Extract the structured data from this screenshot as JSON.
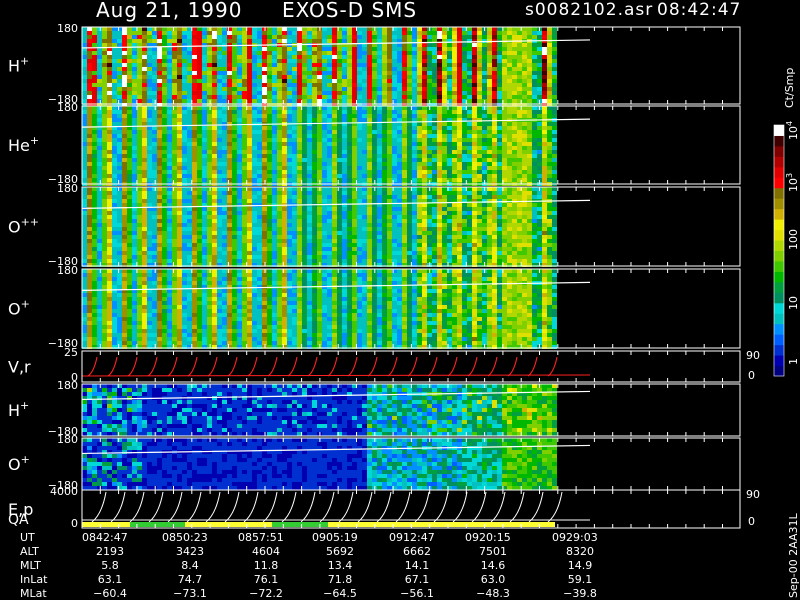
{
  "header": {
    "date": "Aug 21, 1990",
    "instrument": "EXOS-D SMS",
    "file": "s0082102.asr",
    "time": "08:42:47"
  },
  "colorbar": {
    "unit_label": "Ct/Smp",
    "tick_labels": [
      "1",
      "10",
      "100",
      "10",
      "10"
    ],
    "tick_exponents": [
      "",
      "",
      "",
      "3",
      "4"
    ],
    "colors": [
      "#000080",
      "#0000b0",
      "#0030d0",
      "#0060ff",
      "#0090ff",
      "#00c0c0",
      "#00d8d8",
      "#009060",
      "#00a040",
      "#00b800",
      "#40c800",
      "#80d000",
      "#b0d800",
      "#e0e000",
      "#f0f000",
      "#d0b000",
      "#a09000",
      "#807000",
      "#ff0000",
      "#e00000",
      "#b00000",
      "#800000",
      "#400000",
      "#ffffff"
    ]
  },
  "chart_data": {
    "type": "heatmap",
    "panels": [
      {
        "label": "H",
        "superscript": "+",
        "ymax": "180",
        "ymin": "−180"
      },
      {
        "label": "He",
        "superscript": "+",
        "ymax": "180",
        "ymin": "−180"
      },
      {
        "label": "O",
        "superscript": "++",
        "ymax": "180",
        "ymin": "−180"
      },
      {
        "label": "O",
        "superscript": "+",
        "ymax": "180",
        "ymin": "−180"
      },
      {
        "label": "V,r",
        "superscript": "",
        "ymax": "25",
        "ymin": "0",
        "right_max": "90",
        "right_min": "0"
      },
      {
        "label": "H",
        "superscript": "+",
        "ymax": "180",
        "ymin": "−180"
      },
      {
        "label": "O",
        "superscript": "+",
        "ymax": "180",
        "ymin": "−180"
      },
      {
        "label": "E,p",
        "label2": "QA",
        "superscript": "",
        "ymax": "4000",
        "ymin": "0",
        "right_max": "90",
        "right_min": "0"
      }
    ],
    "ephemeris_labels": [
      "UT",
      "ALT",
      "MLT",
      "InLat",
      "MLat"
    ],
    "ephemeris": [
      {
        "UT": "0842:47",
        "ALT": "2193",
        "MLT": "5.8",
        "InLat": "63.1",
        "MLat": "−60.4"
      },
      {
        "UT": "0850:23",
        "ALT": "3423",
        "MLT": "8.4",
        "InLat": "74.7",
        "MLat": "−73.1"
      },
      {
        "UT": "0857:51",
        "ALT": "4604",
        "MLT": "11.8",
        "InLat": "76.1",
        "MLat": "−72.2"
      },
      {
        "UT": "0905:19",
        "ALT": "5692",
        "MLT": "13.4",
        "InLat": "71.8",
        "MLat": "−64.5"
      },
      {
        "UT": "0912:47",
        "ALT": "6662",
        "MLT": "14.1",
        "InLat": "67.1",
        "MLat": "−56.1"
      },
      {
        "UT": "0920:15",
        "ALT": "7501",
        "MLT": "14.6",
        "InLat": "63.0",
        "MLat": "−48.3"
      },
      {
        "UT": "0929:03",
        "ALT": "8320",
        "MLT": "14.9",
        "InLat": "59.1",
        "MLat": "−39.8"
      }
    ]
  },
  "footer": {
    "stamp": "Sep-00 2AA31L"
  }
}
